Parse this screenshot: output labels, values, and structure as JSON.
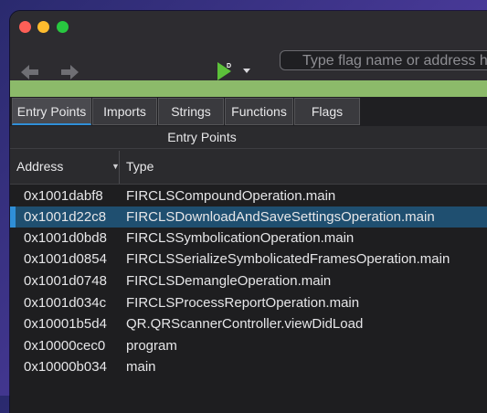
{
  "toolbar": {
    "flag_placeholder": "Type flag name or address here"
  },
  "tabs": [
    {
      "label": "Entry Points"
    },
    {
      "label": "Imports"
    },
    {
      "label": "Strings"
    },
    {
      "label": "Functions"
    },
    {
      "label": "Flags"
    }
  ],
  "section": {
    "title": "Entry Points"
  },
  "table": {
    "headers": {
      "address": "Address",
      "type": "Type"
    },
    "rows": [
      {
        "address": "0x1001dabf8",
        "type": "FIRCLSCompoundOperation.main"
      },
      {
        "address": "0x1001d22c8",
        "type": "FIRCLSDownloadAndSaveSettingsOperation.main"
      },
      {
        "address": "0x1001d0bd8",
        "type": "FIRCLSSymbolicationOperation.main"
      },
      {
        "address": "0x1001d0854",
        "type": "FIRCLSSerializeSymbolicatedFramesOperation.main"
      },
      {
        "address": "0x1001d0748",
        "type": "FIRCLSDemangleOperation.main"
      },
      {
        "address": "0x1001d034c",
        "type": "FIRCLSProcessReportOperation.main"
      },
      {
        "address": "0x10001b5d4",
        "type": "QR.QRScannerController.viewDidLoad"
      },
      {
        "address": "0x10000cec0",
        "type": "program"
      },
      {
        "address": "0x10000b034",
        "type": "main"
      }
    ]
  },
  "colors": {
    "progress": "#8cba6a",
    "selection": "#1f4f70",
    "accent": "#2f8fd8"
  },
  "icons": [
    "back-arrow-icon",
    "forward-arrow-icon",
    "play-debug-icon",
    "chevron-down-icon",
    "sort-indicator-icon"
  ]
}
